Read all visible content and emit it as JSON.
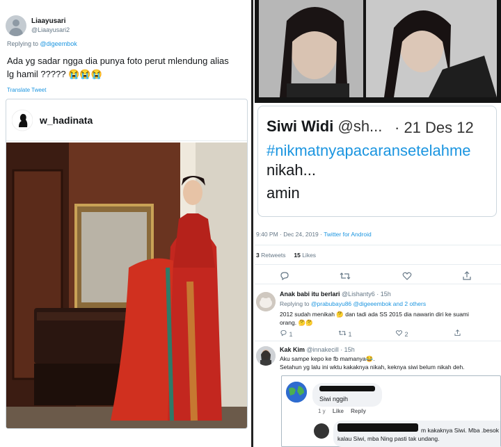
{
  "left_tweet": {
    "name": "Liaayusari",
    "handle": "@Liaayusari2",
    "replying_prefix": "Replying to ",
    "replying_to": "@digeembok",
    "text_line1": "Ada yg sadar ngga dia punya foto perut mlendung alias",
    "text_line2": "lg hamil ????? 😭😭😭",
    "translate": "Translate Tweet",
    "embedded_user": "w_hadinata"
  },
  "quoted": {
    "name": "Siwi Widi",
    "handle": "@sh...",
    "date": "· 21 Des 12",
    "hashtag_line1": "#nikmatnyapacaransetelahme",
    "hashtag_line2": "nikah...",
    "text": "amin"
  },
  "meta": {
    "time": "9:40 PM · Dec 24, 2019 · ",
    "source": "Twitter for Android",
    "retweets_count": "3",
    "retweets_label": "Retweets",
    "likes_count": "15",
    "likes_label": "Likes"
  },
  "reply1": {
    "name": "Anak babi itu berlari",
    "handle": "@Lishanty6 · 15h",
    "replying_prefix": "Replying to ",
    "replying_to": "@prabubayu86 @digeeembok and 2 others",
    "text_line1": "2012 sudah menikah 🤔 dan tadi ada SS 2015 dia nawarin diri ke suami",
    "text_line2": "orang. 🤔🤔",
    "reply_count": "1",
    "retweet_count": "1",
    "like_count": "2"
  },
  "reply2": {
    "name": "Kak Kim",
    "handle": "@innakecill · 15h",
    "text_line1": "Aku sampe kepo ke fb mamanya😂.",
    "text_line2": "Setahun yg lalu ini wktu kakaknya nikah, keknya siwi belum nikah deh."
  },
  "fb": {
    "comment1": "Siwi nggih",
    "time": "1 y",
    "like": "Like",
    "reply": "Reply",
    "comment2_line1": "m kakaknya Siwi. Mba .besok",
    "comment2_line2": "kalau Siwi, mba Ning pasti tak undang."
  },
  "colors": {
    "twitter_blue": "#1b95e0",
    "muted_gray": "#657786"
  }
}
